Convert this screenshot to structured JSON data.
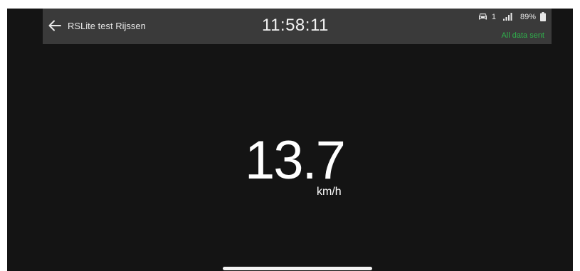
{
  "header": {
    "back_icon": "arrow-left-icon",
    "title": "RSLite test Rijssen",
    "clock": "11:58:11",
    "status": {
      "vehicle_icon": "car-icon",
      "vehicle_count": "1",
      "signal_icon": "signal-bars-icon",
      "battery_percent": "89%",
      "battery_icon": "battery-icon"
    },
    "sync_status": "All data sent",
    "sync_color": "#2fb24c"
  },
  "speed": {
    "value": "13.7",
    "unit": "km/h"
  },
  "colors": {
    "background": "#141414",
    "header_bar": "#3a3a3a",
    "text": "#ffffff"
  }
}
